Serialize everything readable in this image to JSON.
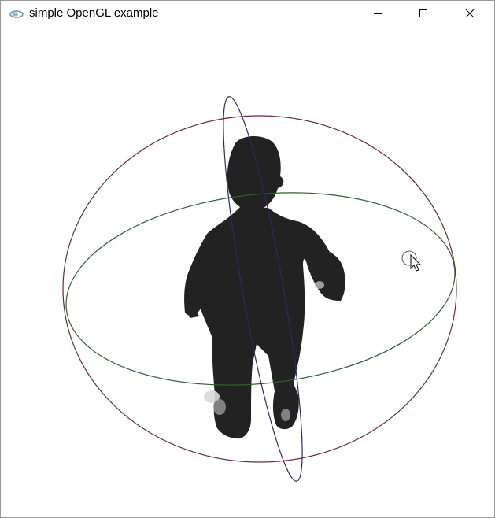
{
  "window": {
    "title": "simple OpenGL example",
    "icon": "opengl-app-icon"
  },
  "controls": {
    "minimize_icon": "minimize-icon",
    "maximize_icon": "maximize-icon",
    "close_icon": "close-icon"
  },
  "scene": {
    "background": "#ffffff",
    "figure_color": "#222222",
    "ring_x_color": "#6b2a33",
    "ring_y_color": "#2f5e32",
    "ring_z_color": "#2a2a6b",
    "cursor_icon": "mouse-pointer-icon"
  }
}
